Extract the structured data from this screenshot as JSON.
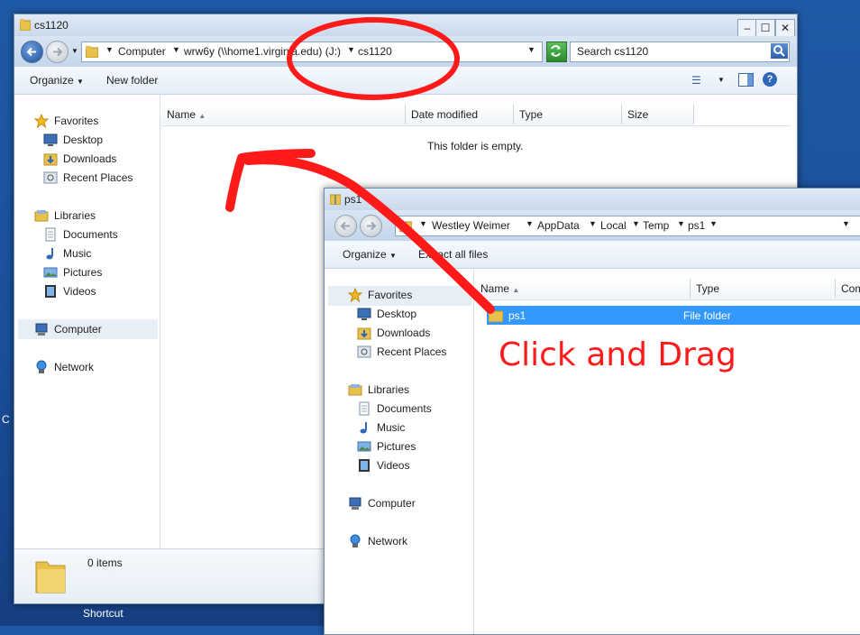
{
  "desktop": {
    "shortcut_label": "Shortcut",
    "edge_letter": "C"
  },
  "window_back": {
    "title": "cs1120",
    "breadcrumb": [
      "Computer",
      "wrw6y (\\\\home1.virginia.edu) (J:)",
      "cs1120"
    ],
    "search_placeholder": "Search cs1120",
    "toolbar": {
      "organize": "Organize",
      "new_folder": "New folder"
    },
    "columns": [
      "Name",
      "Date modified",
      "Type",
      "Size"
    ],
    "empty_message": "This folder is empty.",
    "nav": {
      "favorites": "Favorites",
      "desktop": "Desktop",
      "downloads": "Downloads",
      "recent": "Recent Places",
      "libraries": "Libraries",
      "documents": "Documents",
      "music": "Music",
      "pictures": "Pictures",
      "videos": "Videos",
      "computer": "Computer",
      "network": "Network"
    },
    "status": "0 items"
  },
  "window_front": {
    "title": "ps1",
    "breadcrumb": [
      "Westley Weimer",
      "AppData",
      "Local",
      "Temp",
      "ps1"
    ],
    "toolbar": {
      "organize": "Organize",
      "extract": "Extract all files"
    },
    "columns": [
      "Name",
      "Type",
      "Com"
    ],
    "row": {
      "name": "ps1",
      "type": "File folder"
    },
    "nav": {
      "favorites": "Favorites",
      "desktop": "Desktop",
      "downloads": "Downloads",
      "recent": "Recent Places",
      "libraries": "Libraries",
      "documents": "Documents",
      "music": "Music",
      "pictures": "Pictures",
      "videos": "Videos",
      "computer": "Computer",
      "network": "Network"
    }
  },
  "annotation": {
    "text": "Click and Drag",
    "color": "#ff1a1a"
  },
  "colors": {
    "selection": "#3399ff",
    "accent_folder": "#e8c14a"
  }
}
